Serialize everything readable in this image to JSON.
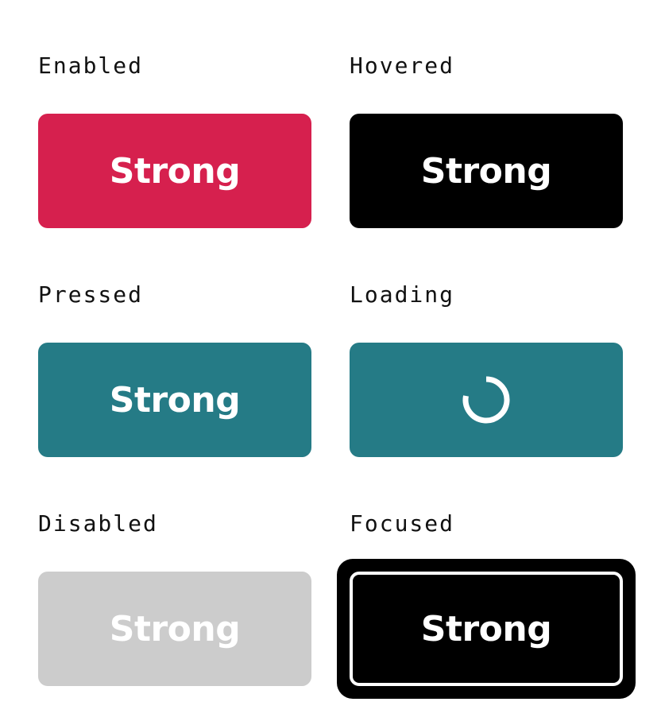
{
  "colors": {
    "enabled": "#d6204e",
    "hovered": "#000000",
    "pressed": "#257b86",
    "loading": "#257b86",
    "disabled": "#cccccc",
    "focused": "#000000",
    "text": "#ffffff"
  },
  "states": {
    "enabled": {
      "label": "Enabled",
      "button_text": "Strong"
    },
    "hovered": {
      "label": "Hovered",
      "button_text": "Strong"
    },
    "pressed": {
      "label": "Pressed",
      "button_text": "Strong"
    },
    "loading": {
      "label": "Loading",
      "icon": "spinner-icon"
    },
    "disabled": {
      "label": "Disabled",
      "button_text": "Strong"
    },
    "focused": {
      "label": "Focused",
      "button_text": "Strong"
    }
  }
}
